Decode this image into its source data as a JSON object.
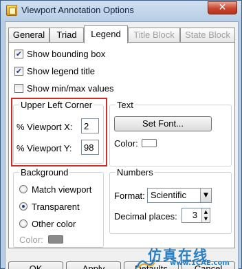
{
  "window": {
    "title": "Viewport Annotation Options",
    "close_label": "✕"
  },
  "tabs": [
    {
      "label": "General",
      "state": "normal"
    },
    {
      "label": "Triad",
      "state": "normal"
    },
    {
      "label": "Legend",
      "state": "active"
    },
    {
      "label": "Title Block",
      "state": "disabled"
    },
    {
      "label": "State Block",
      "state": "disabled"
    }
  ],
  "options": {
    "show_bounding_box": {
      "label": "Show bounding box",
      "checked": true
    },
    "show_legend_title": {
      "label": "Show legend title",
      "checked": true
    },
    "show_min_max": {
      "label": "Show min/max values",
      "checked": false
    }
  },
  "upper_left_corner": {
    "title": "Upper Left Corner",
    "x_label": "% Viewport X:",
    "x_value": "2",
    "y_label": "% Viewport Y:",
    "y_value": "98"
  },
  "text": {
    "title": "Text",
    "set_font_label": "Set Font...",
    "color_label": "Color:",
    "color_value": "#ffffff"
  },
  "background": {
    "title": "Background",
    "options": [
      {
        "label": "Match viewport",
        "selected": false
      },
      {
        "label": "Transparent",
        "selected": true
      },
      {
        "label": "Other color",
        "selected": false
      }
    ],
    "color_label": "Color:",
    "color_value": "#8a8a8a"
  },
  "numbers": {
    "title": "Numbers",
    "format_label": "Format:",
    "format_value": "Scientific",
    "decimal_label": "Decimal places:",
    "decimal_value": "3"
  },
  "buttons": {
    "ok": "OK",
    "apply": "Apply",
    "defaults": "Defaults",
    "cancel": "Cancel"
  },
  "watermark": {
    "cn": "仿真在线",
    "url": "www.1CAE.com"
  },
  "colors": {
    "highlight": "#d12a2a",
    "title_bar": "#b7cde6",
    "close_button": "#c8462d"
  }
}
